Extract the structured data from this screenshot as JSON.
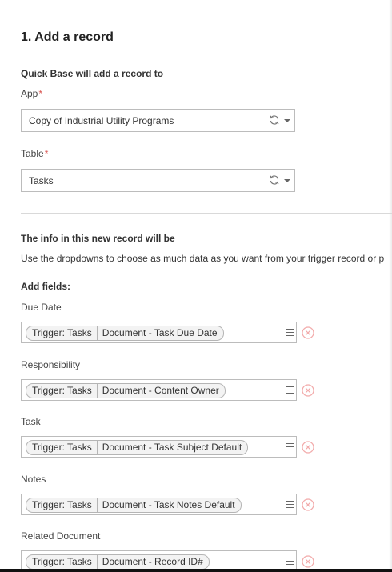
{
  "step": {
    "title": "1. Add a record"
  },
  "target": {
    "heading": "Quick Base will add a record to",
    "app": {
      "label": "App",
      "required_mark": "*",
      "value": "Copy of Industrial Utility Programs"
    },
    "table": {
      "label": "Table",
      "required_mark": "*",
      "value": "Tasks"
    }
  },
  "info": {
    "heading": "The info in this new record will be",
    "description": "Use the dropdowns to choose as much data as you want from your trigger record or p"
  },
  "fields": {
    "heading": "Add fields:",
    "items": [
      {
        "label": "Due Date",
        "source": "Trigger: Tasks",
        "field": "Document - Task Due Date"
      },
      {
        "label": "Responsibility",
        "source": "Trigger: Tasks",
        "field": "Document - Content Owner"
      },
      {
        "label": "Task",
        "source": "Trigger: Tasks",
        "field": "Document - Task Subject Default"
      },
      {
        "label": "Notes",
        "source": "Trigger: Tasks",
        "field": "Document - Task Notes Default"
      },
      {
        "label": "Related Document",
        "source": "Trigger: Tasks",
        "field": "Document - Record ID#"
      }
    ]
  },
  "icons": {
    "refresh": "refresh-icon",
    "caret": "chevron-down-icon",
    "menu": "hamburger-menu-icon",
    "remove": "remove-circle-icon"
  },
  "colors": {
    "required": "#d9534f",
    "remove_icon": "#f2aaaa",
    "token_bg": "#f3f3f3",
    "border": "#bcbcbc"
  }
}
